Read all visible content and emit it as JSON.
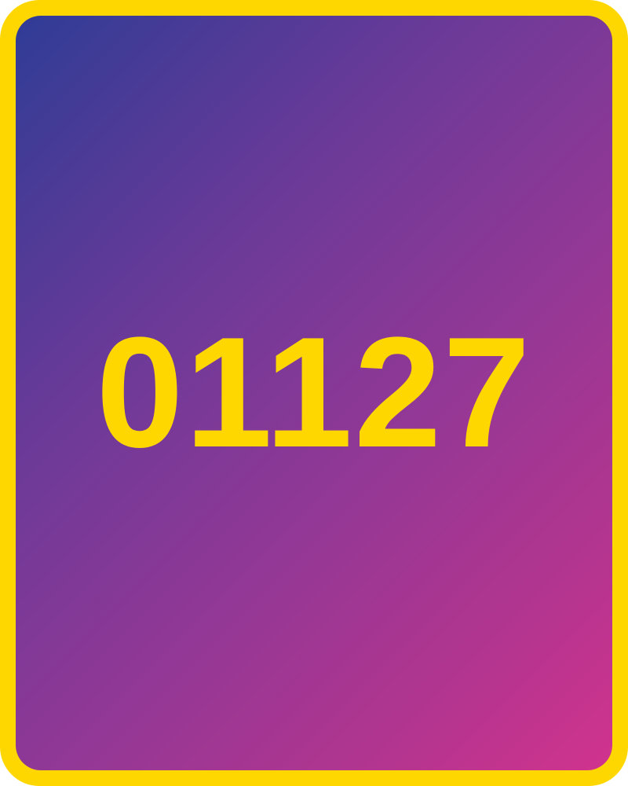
{
  "card": {
    "number": "01127"
  },
  "colors": {
    "border": "#FFD700",
    "text": "#FFD700",
    "gradient_start": "#2F3C96",
    "gradient_end": "#D1338E"
  }
}
